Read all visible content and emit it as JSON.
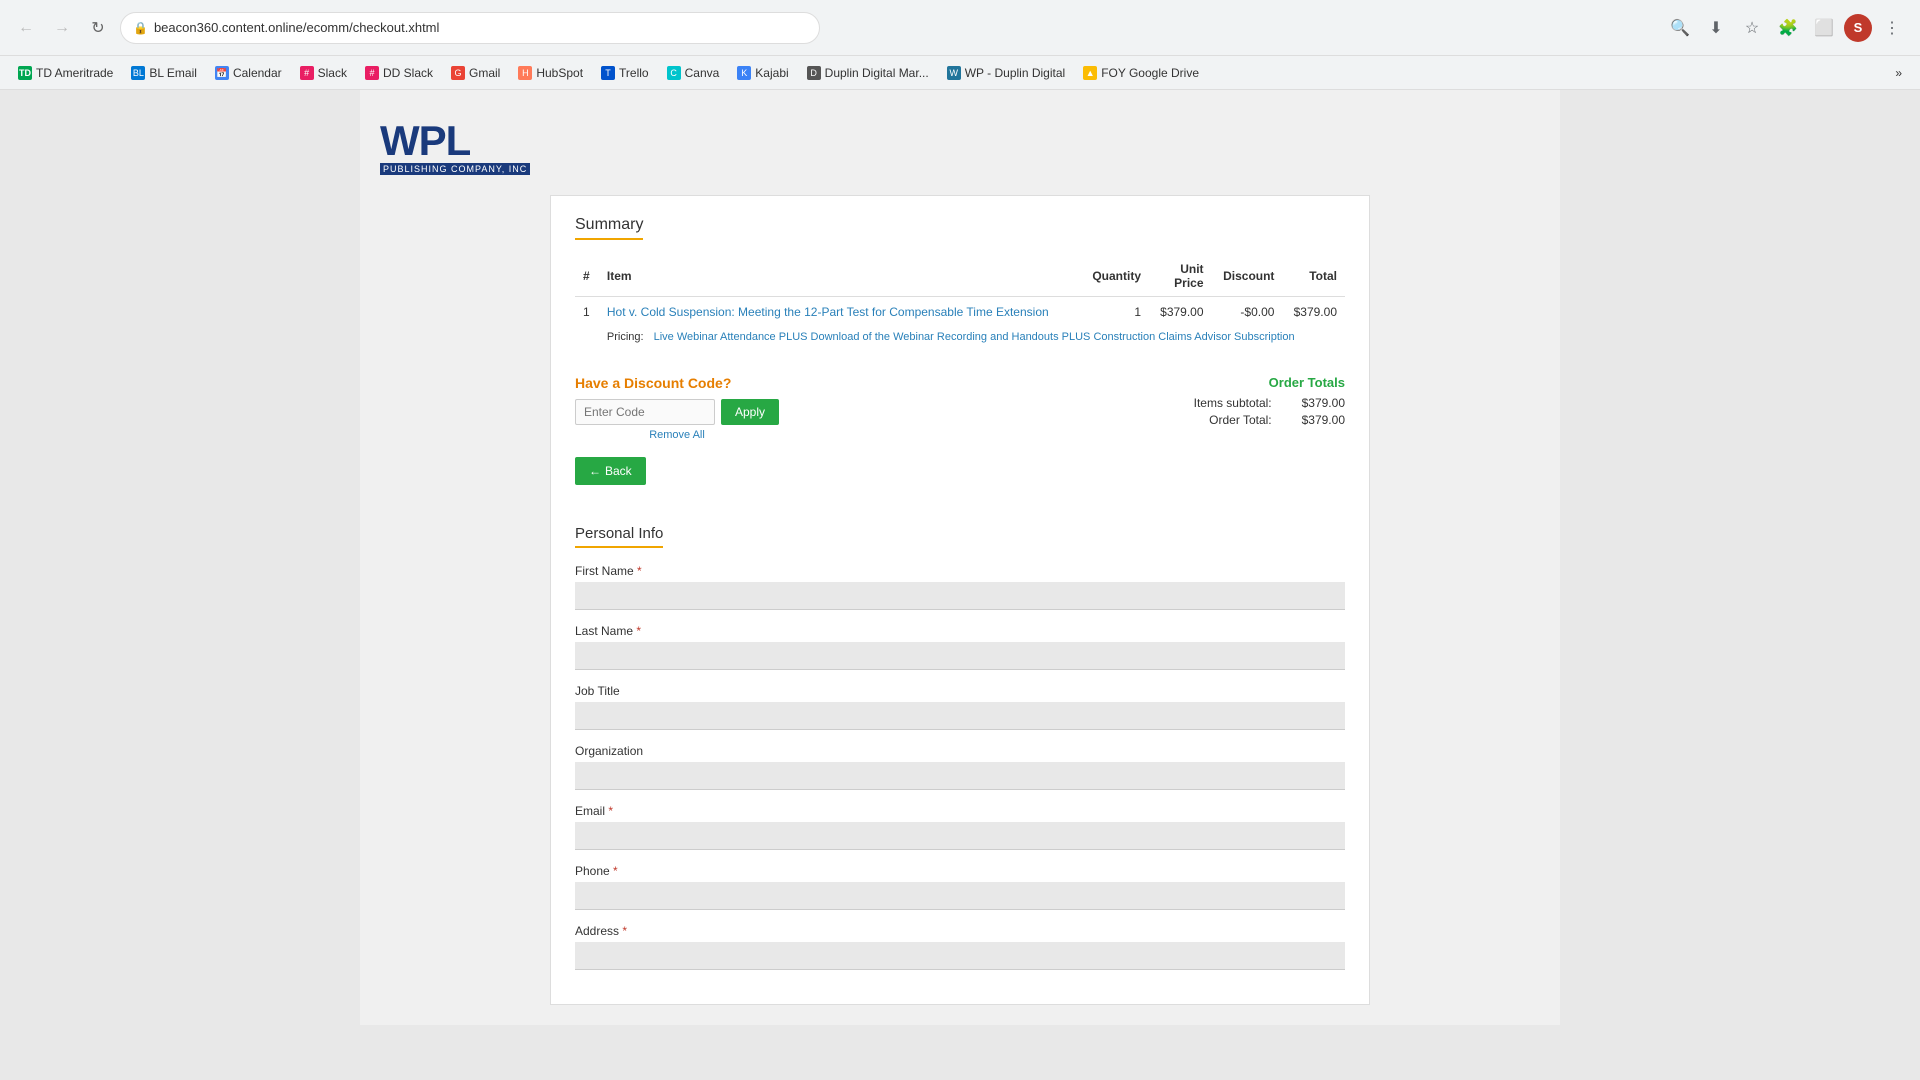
{
  "browser": {
    "url": "beacon360.content.online/ecomm/checkout.xhtml",
    "back_btn": "←",
    "forward_btn": "→",
    "reload_btn": "↻"
  },
  "bookmarks": [
    {
      "id": "td-ameritrade",
      "label": "TD Ameritrade",
      "color": "#00a651"
    },
    {
      "id": "bl-email",
      "label": "BL Email",
      "color": "#0078d4"
    },
    {
      "id": "calendar",
      "label": "Calendar",
      "color": "#4285f4"
    },
    {
      "id": "slack",
      "label": "Slack",
      "color": "#e91e63"
    },
    {
      "id": "dd-slack",
      "label": "DD Slack",
      "color": "#e91e63"
    },
    {
      "id": "gmail",
      "label": "Gmail",
      "color": "#ea4335"
    },
    {
      "id": "hubspot",
      "label": "HubSpot",
      "color": "#ff7a59"
    },
    {
      "id": "trello",
      "label": "Trello",
      "color": "#0052cc"
    },
    {
      "id": "canva",
      "label": "Canva",
      "color": "#00c4cc"
    },
    {
      "id": "kajabi",
      "label": "Kajabi",
      "color": "#3b82f6"
    },
    {
      "id": "duplin-digital-mar",
      "label": "Duplin Digital Mar...",
      "color": "#555"
    },
    {
      "id": "wp-duplin-digital",
      "label": "WP - Duplin Digital",
      "color": "#21759b"
    },
    {
      "id": "foy-google-drive",
      "label": "FOY Google Drive",
      "color": "#fbbc04"
    }
  ],
  "logo": {
    "wpl_text": "WPL",
    "subtitle": "PUBLISHING COMPANY, INC"
  },
  "summary": {
    "title": "Summary",
    "table": {
      "headers": {
        "num": "#",
        "item": "Item",
        "quantity": "Quantity",
        "unit_price": "Unit\nPrice",
        "discount": "Discount",
        "total": "Total"
      },
      "rows": [
        {
          "num": "1",
          "item_link": "Hot v. Cold Suspension: Meeting the 12-Part Test for Compensable Time Extension",
          "pricing_label": "Pricing:",
          "pricing_desc": "Live Webinar Attendance PLUS Download of the Webinar Recording and Handouts PLUS Construction Claims Advisor Subscription",
          "quantity": "1",
          "unit_price": "$379.00",
          "discount": "-$0.00",
          "total": "$379.00"
        }
      ]
    }
  },
  "discount": {
    "heading": "Have a Discount Code?",
    "input_placeholder": "Enter Code",
    "apply_label": "Apply",
    "remove_all_label": "Remove All"
  },
  "order_totals": {
    "heading": "Order Totals",
    "items_subtotal_label": "Items subtotal:",
    "items_subtotal_value": "$379.00",
    "order_total_label": "Order Total:",
    "order_total_value": "$379.00"
  },
  "back_button": {
    "arrow": "←",
    "label": "Back"
  },
  "personal_info": {
    "section_title": "Personal Info",
    "fields": [
      {
        "id": "first-name",
        "label": "First Name",
        "required": true,
        "placeholder": ""
      },
      {
        "id": "last-name",
        "label": "Last Name",
        "required": true,
        "placeholder": ""
      },
      {
        "id": "job-title",
        "label": "Job Title",
        "required": false,
        "placeholder": ""
      },
      {
        "id": "organization",
        "label": "Organization",
        "required": false,
        "placeholder": ""
      },
      {
        "id": "email",
        "label": "Email",
        "required": true,
        "placeholder": ""
      },
      {
        "id": "phone",
        "label": "Phone",
        "required": true,
        "placeholder": ""
      },
      {
        "id": "address",
        "label": "Address",
        "required": true,
        "placeholder": ""
      }
    ]
  }
}
